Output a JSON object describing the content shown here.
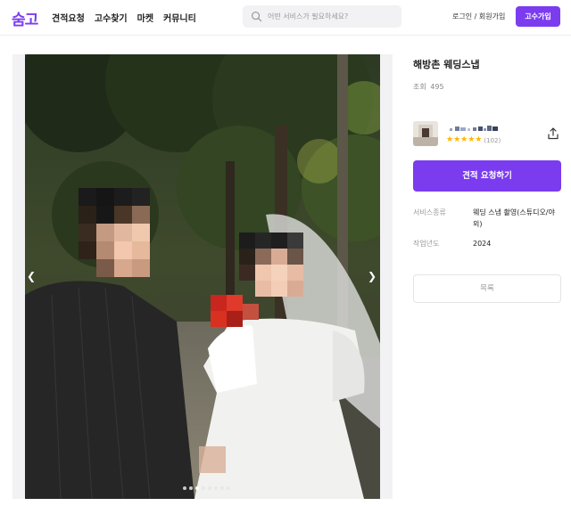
{
  "header": {
    "logo": "숨고",
    "nav": [
      "견적요청",
      "고수찾기",
      "마켓",
      "커뮤니티"
    ],
    "search_placeholder": "어떤 서비스가 필요하세요?",
    "login_label": "로그인 / 회원가입",
    "join_label": "고수가입"
  },
  "gallery": {
    "dots_total": 8,
    "active_dot": 2,
    "prev_icon": "chevron-left-icon",
    "next_icon": "chevron-right-icon"
  },
  "portfolio": {
    "title": "해방촌 웨딩스냅",
    "views_label": "조회",
    "views_count": "495",
    "pro": {
      "rating": 5,
      "review_count": "(102)"
    },
    "quote_button": "견적 요청하기",
    "details": [
      {
        "label": "서비스종류",
        "value": "웨딩 스냅 촬영(스튜디오/야외)"
      },
      {
        "label": "작업년도",
        "value": "2024"
      }
    ],
    "list_button": "목록"
  },
  "colors": {
    "brand": "#7b3cf0",
    "star": "#ffb400"
  }
}
